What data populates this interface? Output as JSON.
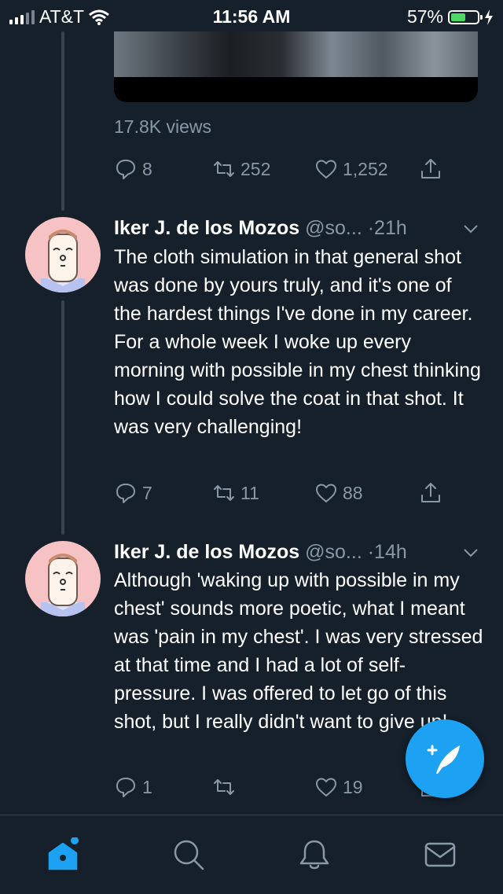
{
  "status_bar": {
    "carrier": "AT&T",
    "time": "11:56 AM",
    "battery_percent": "57%",
    "battery_level": 0.57,
    "battery_color": "#4cd964"
  },
  "top_tweet": {
    "views": "17.8K views",
    "replies": "8",
    "retweets": "252",
    "likes": "1,252"
  },
  "tweets": [
    {
      "name": "Iker J. de los Mozos",
      "handle": "@so...",
      "separator": "·",
      "time": "21h",
      "text": "The cloth simulation in that general shot was done by yours truly, and it's one of the hardest things I've done in my career. For a whole week I woke up every morning with possible in my chest thinking how I could solve the coat in that shot. It was very challenging!",
      "replies": "7",
      "retweets": "11",
      "likes": "88"
    },
    {
      "name": "Iker J. de los Mozos",
      "handle": "@so...",
      "separator": "·",
      "time": "14h",
      "text": "Although 'waking up with possible in my chest' sounds more poetic, what I meant was 'pain in my chest'. I was very stressed at that time and I had a lot of self-pressure. I was offered to let go of this shot, but I really didn't want to give up!",
      "replies": "1",
      "retweets": "",
      "likes": "19"
    }
  ],
  "colors": {
    "background": "#15202b",
    "accent": "#1da1f2",
    "secondary_text": "#8899a6",
    "divider": "#38444d"
  },
  "icons": {
    "reply": "reply-icon",
    "retweet": "retweet-icon",
    "like": "heart-icon",
    "share": "share-icon",
    "compose": "compose-tweet-icon",
    "home": "home-icon",
    "search": "search-icon",
    "notifications": "bell-icon",
    "messages": "mail-icon"
  }
}
